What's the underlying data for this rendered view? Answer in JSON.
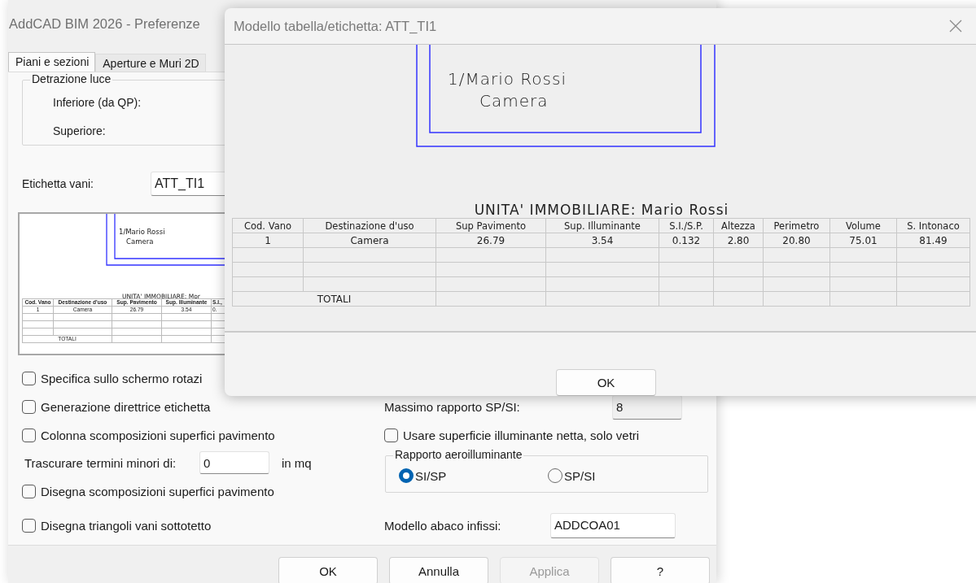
{
  "back_window": {
    "title": "AddCAD BIM 2026 - Preferenze",
    "tabs": [
      {
        "label": "Piani e sezioni",
        "selected": true
      },
      {
        "label": "Aperture e Muri 2D",
        "selected": false
      }
    ],
    "detrazione_luce": {
      "legend": "Detrazione luce",
      "fields": [
        {
          "label": "Inferiore (da QP):"
        },
        {
          "label": "Superiore:"
        }
      ]
    },
    "etichetta_vani": {
      "label": "Etichetta vani:",
      "value": "ATT_TI1"
    },
    "preview": {
      "label_lines": [
        "1/Mario Rossi",
        "Camera"
      ],
      "title": "UNITA' IMMOBILIARE: Mor",
      "columns": [
        "Cod. Vano",
        "Destinazione d'uso",
        "Sup. Pavimento",
        "Sup. Illuminante",
        "S.I.,"
      ],
      "rows": [
        [
          "1",
          "Camera",
          "26.79",
          "3.54",
          "0."
        ]
      ],
      "totals_label": "TOTALI"
    },
    "left_options": [
      {
        "kind": "checkbox",
        "label": "Specifica sullo schermo rotazi",
        "checked": false
      },
      {
        "kind": "checkbox",
        "label": "Generazione direttrice etichetta",
        "checked": false
      },
      {
        "kind": "checkbox",
        "label": "Colonna scomposizioni superfici pavimento",
        "checked": false
      },
      {
        "kind": "number",
        "label": "Trascurare termini minori di:",
        "value": "0",
        "unit": "in mq"
      },
      {
        "kind": "checkbox",
        "label": "Disegna scomposizioni superfici pavimento",
        "checked": false
      },
      {
        "kind": "checkbox",
        "label": "Disegna triangoli vani sottotetto",
        "checked": false
      }
    ],
    "massimo_rapporto": {
      "label": "Massimo rapporto SP/SI:",
      "value": "8",
      "disabled": true
    },
    "usare_superficie": {
      "label": "Usare superficie illuminante netta, solo vetri",
      "checked": false
    },
    "rapporto_aeroilluminante": {
      "legend": "Rapporto aeroilluminante",
      "options": [
        {
          "label": "SI/SP",
          "selected": true
        },
        {
          "label": "SP/SI",
          "selected": false
        }
      ]
    },
    "modello_abaco": {
      "label": "Modello abaco infissi:",
      "value": "ADDCOA01"
    },
    "buttons": [
      {
        "label": "OK",
        "disabled": false
      },
      {
        "label": "Annulla",
        "disabled": false
      },
      {
        "label": "Applica",
        "disabled": true
      },
      {
        "label": "?",
        "disabled": false
      }
    ]
  },
  "dialog": {
    "title": "Modello tabella/etichetta: ATT_TI1",
    "label_lines": [
      "1/Mario Rossi",
      "Camera"
    ],
    "table_title": "UNITA' IMMOBILIARE: Mario Rossi",
    "columns": [
      "Cod. Vano",
      "Destinazione d'uso",
      "Sup  Pavimento",
      "Sup. Illuminante",
      "S.I./S.P.",
      "Altezza",
      "Perimetro",
      "Volume",
      "S. Intonaco"
    ],
    "rows": [
      [
        "1",
        "Camera",
        "26.79",
        "3.54",
        "0.132",
        "2.80",
        "20.80",
        "75.01",
        "81.49"
      ]
    ],
    "totals_label": "TOTALI",
    "button": "OK"
  }
}
